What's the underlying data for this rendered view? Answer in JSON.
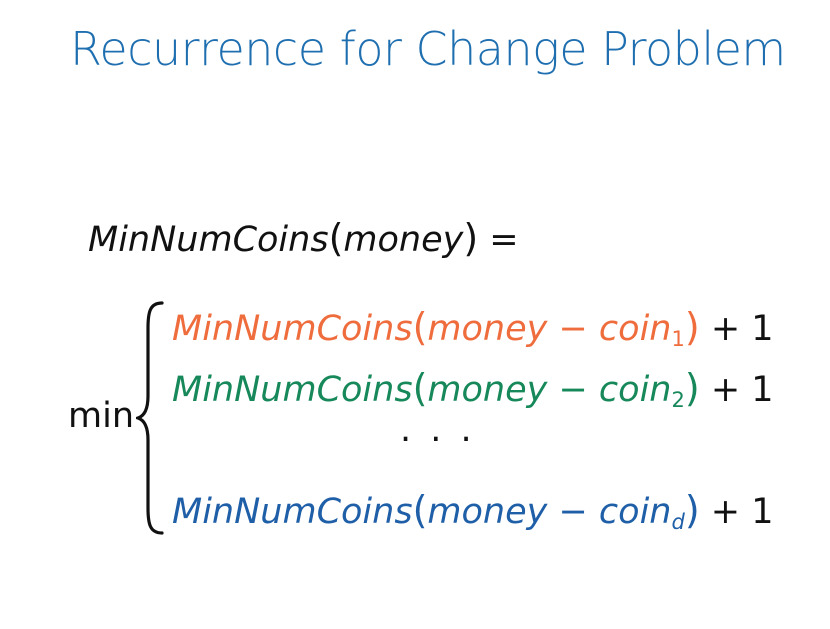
{
  "slide": {
    "title": "Recurrence for Change Problem",
    "title_color": "#1f6fb0"
  },
  "equation": {
    "lhs_func": "MinNumCoins",
    "lhs_open": "(",
    "lhs_arg": "money",
    "lhs_close": ")",
    "equals": " =",
    "min_label": "min",
    "cases": [
      {
        "func": "MinNumCoins",
        "open": "(",
        "arg": "money",
        "minus": " − ",
        "coin": "coin",
        "index": "1",
        "close": ")",
        "plus": " + 1",
        "color": "#ef6c3d"
      },
      {
        "func": "MinNumCoins",
        "open": "(",
        "arg": "money",
        "minus": " − ",
        "coin": "coin",
        "index": "2",
        "close": ")",
        "plus": " + 1",
        "color": "#16885a"
      },
      {
        "func": "MinNumCoins",
        "open": "(",
        "arg": "money",
        "minus": " − ",
        "coin": "coin",
        "index": "d",
        "close": ")",
        "plus": " + 1",
        "color": "#1f5fa8"
      }
    ],
    "ellipsis": "· · ·"
  }
}
